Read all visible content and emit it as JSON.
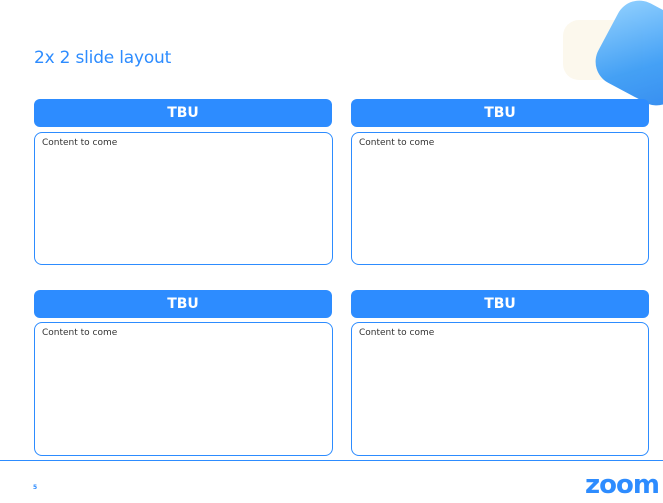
{
  "slide": {
    "title": "2x 2 slide layout",
    "page_number": "5",
    "logo_text": "zoom"
  },
  "panels": [
    {
      "header": "TBU",
      "body": "Content to come"
    },
    {
      "header": "TBU",
      "body": "Content to come"
    },
    {
      "header": "TBU",
      "body": "Content to come"
    },
    {
      "header": "TBU",
      "body": "Content to come"
    }
  ],
  "colors": {
    "accent": "#2d8cff",
    "background": "#ffffff",
    "text": "#333333"
  }
}
